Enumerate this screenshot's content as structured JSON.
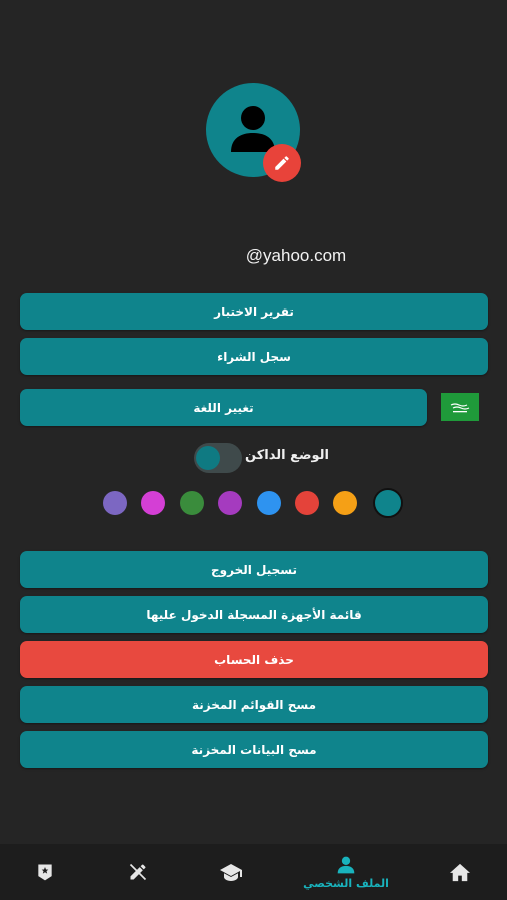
{
  "profile": {
    "email": "@yahoo.com"
  },
  "buttons": {
    "exam_report": "تقرير الاختبار",
    "purchase_history": "سجل الشراء",
    "change_language": "تغيير اللغة",
    "logout": "تسجيل الخروج",
    "registered_devices": "قائمة الأجهزة المسجلة الدخول عليها",
    "delete_account": "حذف الحساب",
    "clear_saved_lists": "مسح القوائم المخزنة",
    "clear_saved_data": "مسح البيانات المخزنة"
  },
  "dark_mode": {
    "label": "الوضع الداكن",
    "enabled": true
  },
  "theme_colors": [
    "#7c67c2",
    "#d43fd5",
    "#3a8c3c",
    "#a53bbf",
    "#2e93f0",
    "#e4433a",
    "#f5a016",
    "#0f848c"
  ],
  "selected_color": "#0f848c",
  "colors": {
    "primary": "#0f848c",
    "danger": "#e8493f",
    "background": "#252525",
    "nav_active": "#19b3bd"
  },
  "nav": {
    "profile_label": "الملف الشخصي",
    "items": [
      "home-icon",
      "profile-icon",
      "school-icon",
      "edit-icon",
      "bookmark-icon"
    ],
    "active": "profile-icon"
  },
  "flag": "saudi-flag"
}
